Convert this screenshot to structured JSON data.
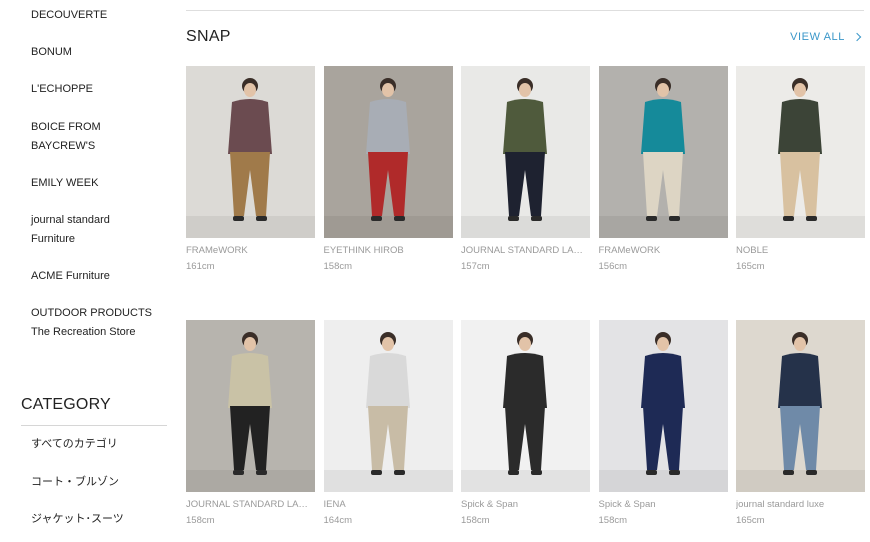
{
  "sidebar": {
    "brands": [
      {
        "lines": [
          "DECOUVERTE"
        ]
      },
      {
        "lines": [
          "BONUM"
        ]
      },
      {
        "lines": [
          "L'ECHOPPE"
        ]
      },
      {
        "lines": [
          "BOICE FROM",
          "BAYCREW'S"
        ]
      },
      {
        "lines": [
          "EMILY WEEK"
        ]
      },
      {
        "lines": [
          "journal standard",
          "Furniture"
        ]
      },
      {
        "lines": [
          "ACME Furniture"
        ]
      },
      {
        "lines": [
          "OUTDOOR PRODUCTS",
          "The Recreation Store"
        ]
      }
    ],
    "category_title": "CATEGORY",
    "categories": [
      "すべてのカテゴリ",
      "コート・ブルゾン",
      "ジャケット･スーツ"
    ]
  },
  "snap": {
    "title": "SNAP",
    "view_all": "VIEW ALL",
    "items": [
      {
        "brand": "FRAMeWORK",
        "height": "161cm",
        "bg": "#dcdad6",
        "top": "#6b4b50",
        "bottom": "#a07a4a"
      },
      {
        "brand": "EYETHINK HIROB",
        "height": "158cm",
        "bg": "#a9a49d",
        "top": "#a8adb5",
        "bottom": "#b02a2a"
      },
      {
        "brand": "JOURNAL STANDARD LA…",
        "height": "157cm",
        "bg": "#e9e9e7",
        "top": "#4f5a3c",
        "bottom": "#1e2230"
      },
      {
        "brand": "FRAMeWORK",
        "height": "156cm",
        "bg": "#b3b1ad",
        "top": "#158a9a",
        "bottom": "#ddd5c4"
      },
      {
        "brand": "NOBLE",
        "height": "165cm",
        "bg": "#ecebe8",
        "top": "#3c4437",
        "bottom": "#d8c1a0"
      },
      {
        "brand": "JOURNAL STANDARD LA…",
        "height": "158cm",
        "bg": "#b7b4ae",
        "top": "#c9c2a6",
        "bottom": "#222222"
      },
      {
        "brand": "IENA",
        "height": "164cm",
        "bg": "#eeeeee",
        "top": "#d9d9d9",
        "bottom": "#c8bca6"
      },
      {
        "brand": "Spick & Span",
        "height": "158cm",
        "bg": "#f1f1f1",
        "top": "#2b2b2b",
        "bottom": "#2b2b2b"
      },
      {
        "brand": "Spick & Span",
        "height": "158cm",
        "bg": "#e3e3e5",
        "top": "#1e2a55",
        "bottom": "#1e2a55"
      },
      {
        "brand": "journal standard luxe",
        "height": "165cm",
        "bg": "#ddd8cf",
        "top": "#25324a",
        "bottom": "#6f8aa8"
      }
    ]
  }
}
